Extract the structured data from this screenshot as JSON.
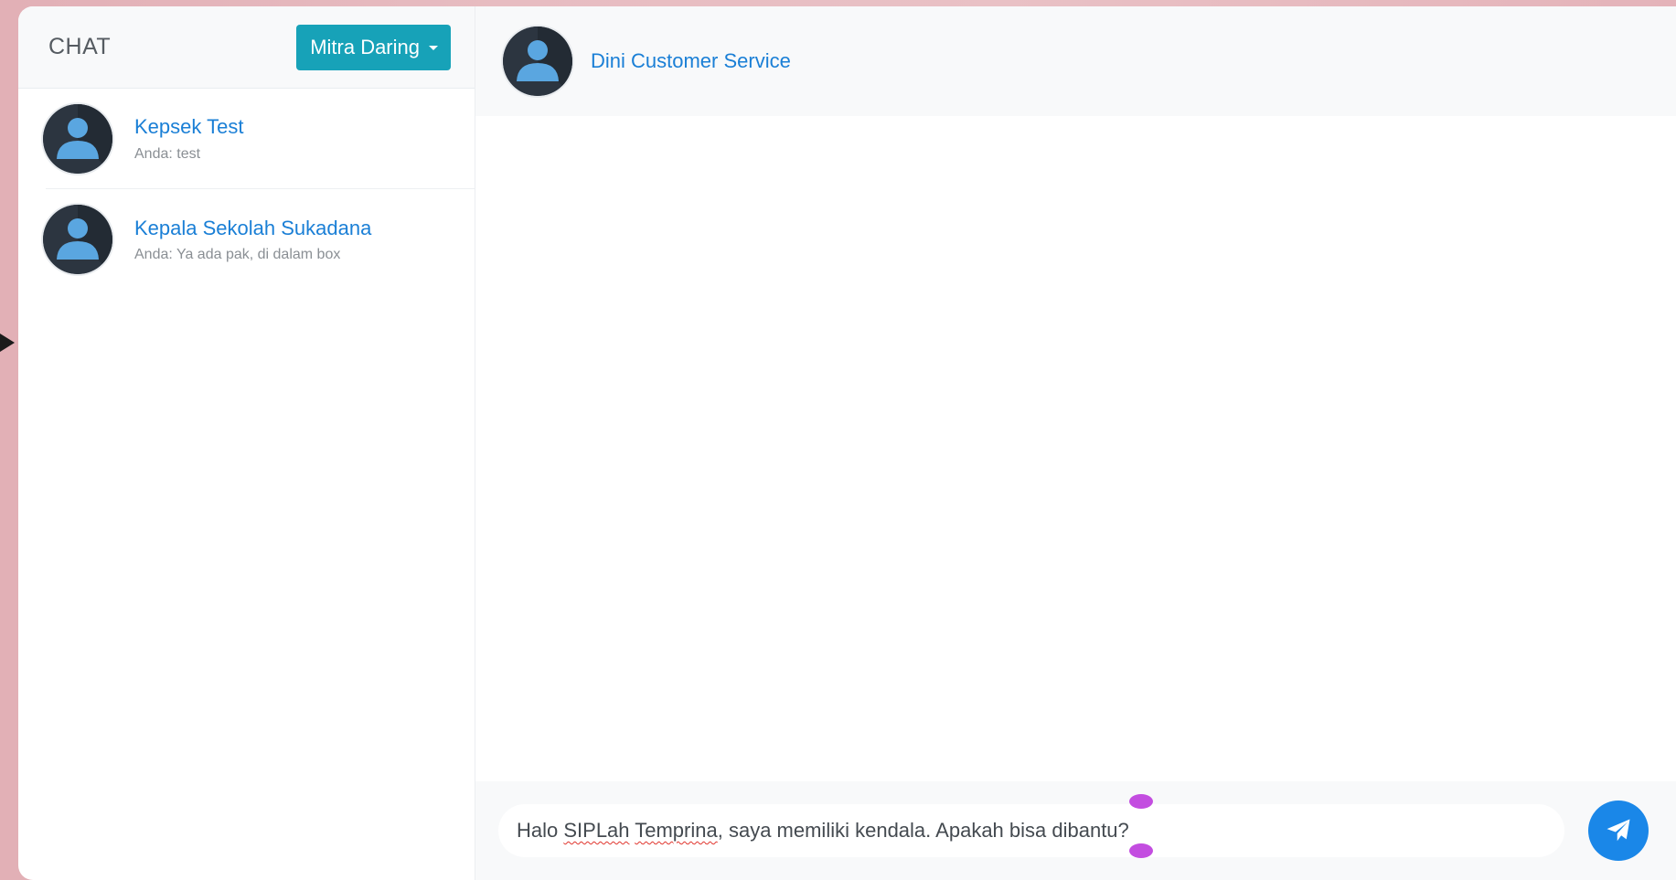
{
  "sidebar": {
    "title": "CHAT",
    "status_dropdown": {
      "label": "Mitra Daring"
    },
    "chats": [
      {
        "name": "Kepsek Test",
        "preview": "Anda: test"
      },
      {
        "name": "Kepala Sekolah Sukadana",
        "preview": "Anda: Ya ada pak, di dalam box"
      }
    ]
  },
  "conversation": {
    "contact_name": "Dini Customer Service"
  },
  "composer": {
    "text_before": "Halo ",
    "misspelled_1": "SIPLah",
    "text_space": " ",
    "misspelled_2": "Temprina",
    "text_after": ", saya memiliki kendala. Apakah bisa dibantu?"
  },
  "icons": {
    "avatar": "user-avatar-icon",
    "dropdown": "caret-down-icon",
    "send": "paper-plane-icon"
  },
  "colors": {
    "accent_teal": "#17a2b8",
    "link_blue": "#1a7fd6",
    "send_blue": "#1a87e8"
  }
}
